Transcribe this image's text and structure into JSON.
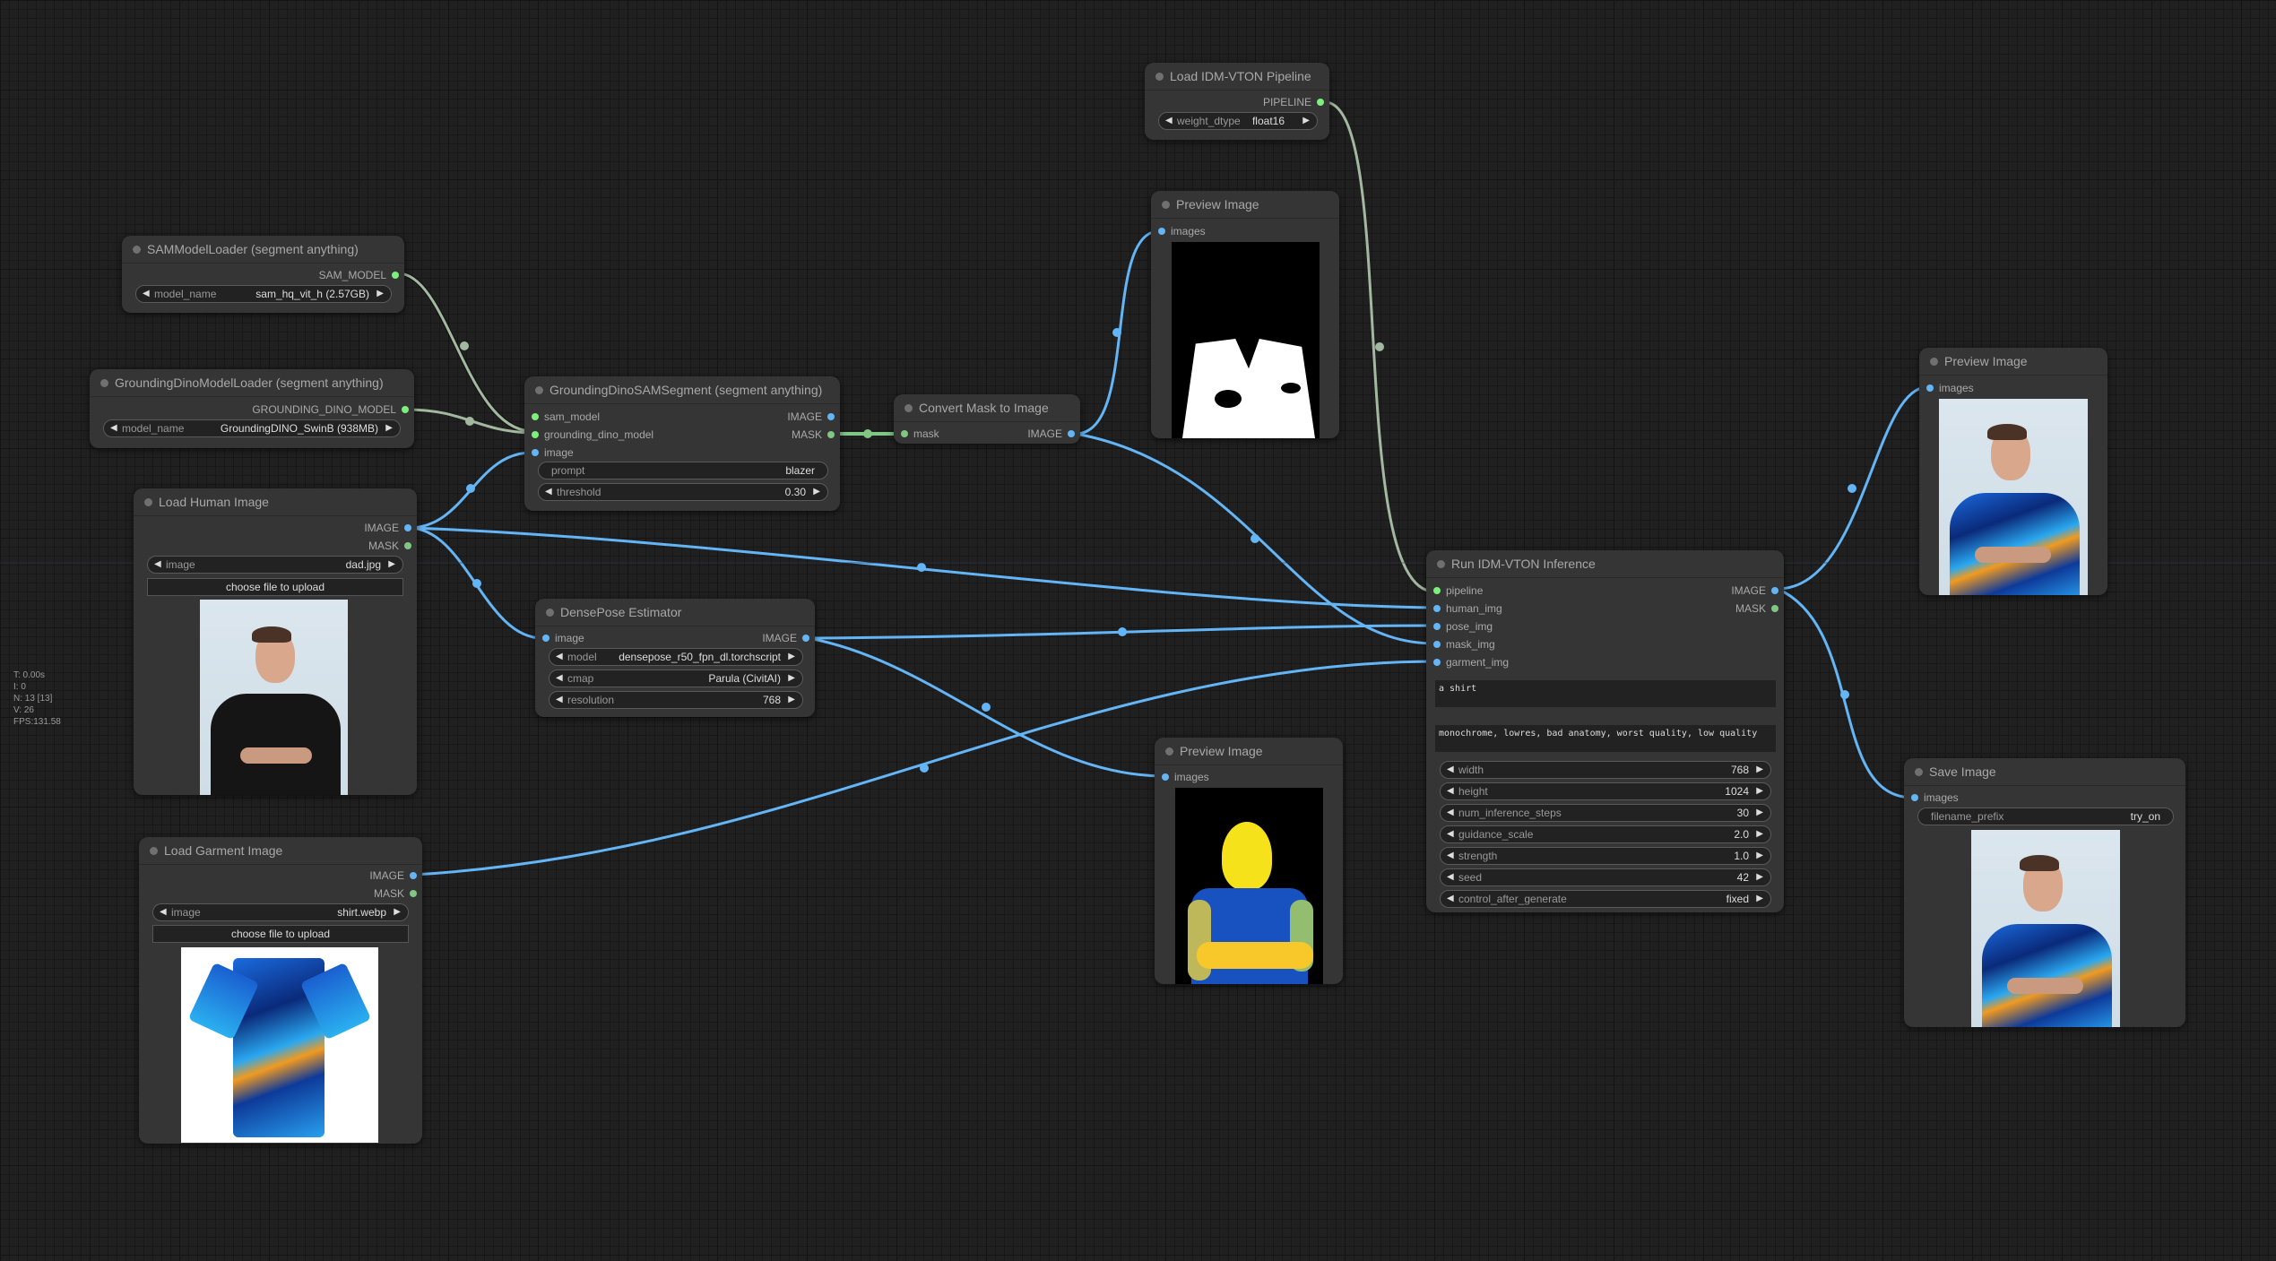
{
  "stats": [
    "T: 0.00s",
    "I: 0",
    "N: 13 [13]",
    "V: 26",
    "FPS:131.58"
  ],
  "colors": {
    "image_link": "#64b5f6",
    "mask_link": "#81c784",
    "model_link": "#a3b8a0",
    "background": "#202020",
    "node": "#353535"
  },
  "nodes": {
    "sam_loader": {
      "title": "SAMModelLoader (segment anything)",
      "output": "SAM_MODEL",
      "widget_label": "model_name",
      "widget_value": "sam_hq_vit_h (2.57GB)"
    },
    "dino_loader": {
      "title": "GroundingDinoModelLoader (segment anything)",
      "output": "GROUNDING_DINO_MODEL",
      "widget_label": "model_name",
      "widget_value": "GroundingDINO_SwinB (938MB)"
    },
    "segment": {
      "title": "GroundingDinoSAMSegment (segment anything)",
      "inputs": [
        "sam_model",
        "grounding_dino_model",
        "image"
      ],
      "outputs": [
        "IMAGE",
        "MASK"
      ],
      "prompt_label": "prompt",
      "prompt_value": "blazer",
      "threshold_label": "threshold",
      "threshold_value": "0.30"
    },
    "convert_mask": {
      "title": "Convert Mask to Image",
      "input": "mask",
      "output": "IMAGE"
    },
    "load_human": {
      "title": "Load Human Image",
      "outputs": [
        "IMAGE",
        "MASK"
      ],
      "widget_label": "image",
      "widget_value": "dad.jpg",
      "upload_label": "choose file to upload"
    },
    "densepose": {
      "title": "DensePose Estimator",
      "input": "image",
      "output": "IMAGE",
      "model_label": "model",
      "model_value": "densepose_r50_fpn_dl.torchscript",
      "cmap_label": "cmap",
      "cmap_value": "Parula (CivitAI)",
      "resolution_label": "resolution",
      "resolution_value": "768"
    },
    "load_garment": {
      "title": "Load Garment Image",
      "outputs": [
        "IMAGE",
        "MASK"
      ],
      "widget_label": "image",
      "widget_value": "shirt.webp",
      "upload_label": "choose file to upload"
    },
    "load_pipeline": {
      "title": "Load IDM-VTON Pipeline",
      "output": "PIPELINE",
      "widget_label": "weight_dtype",
      "widget_value": "float16"
    },
    "preview_mask": {
      "title": "Preview Image",
      "input": "images"
    },
    "preview_pose": {
      "title": "Preview Image",
      "input": "images"
    },
    "preview_result": {
      "title": "Preview Image",
      "input": "images"
    },
    "run_inference": {
      "title": "Run IDM-VTON Inference",
      "inputs": [
        "pipeline",
        "human_img",
        "pose_img",
        "mask_img",
        "garment_img"
      ],
      "outputs": [
        "IMAGE",
        "MASK"
      ],
      "prompt": "a shirt",
      "negative_prompt": "monochrome, lowres, bad anatomy, worst quality, low quality",
      "widgets": [
        {
          "label": "width",
          "value": "768"
        },
        {
          "label": "height",
          "value": "1024"
        },
        {
          "label": "num_inference_steps",
          "value": "30"
        },
        {
          "label": "guidance_scale",
          "value": "2.0"
        },
        {
          "label": "strength",
          "value": "1.0"
        },
        {
          "label": "seed",
          "value": "42"
        },
        {
          "label": "control_after_generate",
          "value": "fixed"
        }
      ]
    },
    "save_image": {
      "title": "Save Image",
      "input": "images",
      "widget_label": "filename_prefix",
      "widget_value": "try_on"
    }
  },
  "icons": {
    "decrement": "◀",
    "increment": "▶"
  }
}
